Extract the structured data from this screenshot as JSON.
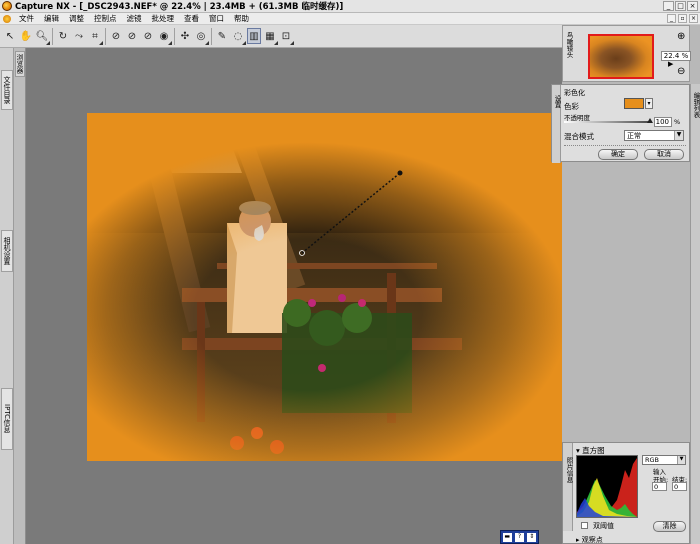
{
  "window": {
    "title": "Capture NX - [_DSC2943.NEF* @ 22.4% | 23.4MB + (61.3MB 临时缓存)]"
  },
  "menubar": {
    "items": [
      "文件",
      "编辑",
      "调整",
      "控制点",
      "滤镜",
      "批处理",
      "查看",
      "窗口",
      "帮助"
    ]
  },
  "left_tabs": [
    "文件目录",
    "相机设置",
    "IPTC信息"
  ],
  "left_tabs2": [
    "浏览器"
  ],
  "navigator": {
    "label": "鸟瞰镜头",
    "zoom": "22.4 %"
  },
  "right_tab": "编辑列表",
  "colorize": {
    "side_label": "设置",
    "title": "彩色化",
    "color_label": "色彩",
    "swatch_color": "#e68f1c",
    "opacity_label": "不透明度",
    "opacity_value": "100",
    "opacity_unit": "%",
    "blend_label": "混合模式",
    "blend_value": "正常",
    "ok_label": "确定",
    "cancel_label": "取消"
  },
  "histogram": {
    "side_label": "照片信息",
    "title": "直方图",
    "channel": "RGB",
    "input_label": "输入",
    "start_label": "开始:",
    "end_label": "结束:",
    "start_value": "0",
    "end_value": "0",
    "dual_label": "双阈值",
    "clear_label": "清除",
    "watch_label": "观察点"
  },
  "colors": {
    "accent_orange": "#e68f1c",
    "selection_red": "#e21b1b"
  },
  "icons": [
    "arrow",
    "hand",
    "zoom",
    "rotate",
    "straighten",
    "crop",
    "black-point",
    "white-point",
    "neutral-point",
    "red-eye",
    "color-point",
    "brush",
    "lasso",
    "gradient",
    "fill"
  ]
}
